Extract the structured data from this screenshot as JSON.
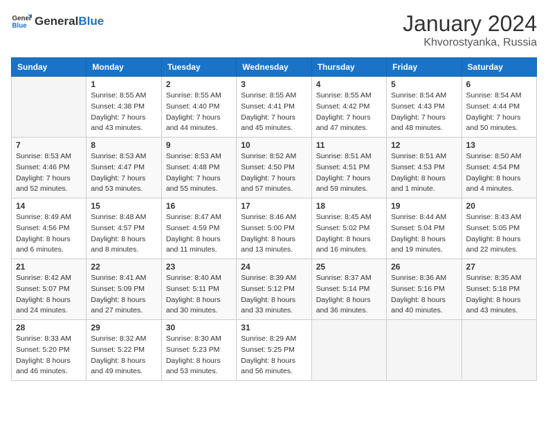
{
  "header": {
    "logo_general": "General",
    "logo_blue": "Blue",
    "title": "January 2024",
    "subtitle": "Khvorostyanka, Russia"
  },
  "days_of_week": [
    "Sunday",
    "Monday",
    "Tuesday",
    "Wednesday",
    "Thursday",
    "Friday",
    "Saturday"
  ],
  "weeks": [
    [
      {
        "num": "",
        "sunrise": "",
        "sunset": "",
        "daylight": "",
        "empty": true
      },
      {
        "num": "1",
        "sunrise": "Sunrise: 8:55 AM",
        "sunset": "Sunset: 4:38 PM",
        "daylight": "Daylight: 7 hours and 43 minutes."
      },
      {
        "num": "2",
        "sunrise": "Sunrise: 8:55 AM",
        "sunset": "Sunset: 4:40 PM",
        "daylight": "Daylight: 7 hours and 44 minutes."
      },
      {
        "num": "3",
        "sunrise": "Sunrise: 8:55 AM",
        "sunset": "Sunset: 4:41 PM",
        "daylight": "Daylight: 7 hours and 45 minutes."
      },
      {
        "num": "4",
        "sunrise": "Sunrise: 8:55 AM",
        "sunset": "Sunset: 4:42 PM",
        "daylight": "Daylight: 7 hours and 47 minutes."
      },
      {
        "num": "5",
        "sunrise": "Sunrise: 8:54 AM",
        "sunset": "Sunset: 4:43 PM",
        "daylight": "Daylight: 7 hours and 48 minutes."
      },
      {
        "num": "6",
        "sunrise": "Sunrise: 8:54 AM",
        "sunset": "Sunset: 4:44 PM",
        "daylight": "Daylight: 7 hours and 50 minutes."
      }
    ],
    [
      {
        "num": "7",
        "sunrise": "Sunrise: 8:53 AM",
        "sunset": "Sunset: 4:46 PM",
        "daylight": "Daylight: 7 hours and 52 minutes."
      },
      {
        "num": "8",
        "sunrise": "Sunrise: 8:53 AM",
        "sunset": "Sunset: 4:47 PM",
        "daylight": "Daylight: 7 hours and 53 minutes."
      },
      {
        "num": "9",
        "sunrise": "Sunrise: 8:53 AM",
        "sunset": "Sunset: 4:48 PM",
        "daylight": "Daylight: 7 hours and 55 minutes."
      },
      {
        "num": "10",
        "sunrise": "Sunrise: 8:52 AM",
        "sunset": "Sunset: 4:50 PM",
        "daylight": "Daylight: 7 hours and 57 minutes."
      },
      {
        "num": "11",
        "sunrise": "Sunrise: 8:51 AM",
        "sunset": "Sunset: 4:51 PM",
        "daylight": "Daylight: 7 hours and 59 minutes."
      },
      {
        "num": "12",
        "sunrise": "Sunrise: 8:51 AM",
        "sunset": "Sunset: 4:53 PM",
        "daylight": "Daylight: 8 hours and 1 minute."
      },
      {
        "num": "13",
        "sunrise": "Sunrise: 8:50 AM",
        "sunset": "Sunset: 4:54 PM",
        "daylight": "Daylight: 8 hours and 4 minutes."
      }
    ],
    [
      {
        "num": "14",
        "sunrise": "Sunrise: 8:49 AM",
        "sunset": "Sunset: 4:56 PM",
        "daylight": "Daylight: 8 hours and 6 minutes."
      },
      {
        "num": "15",
        "sunrise": "Sunrise: 8:48 AM",
        "sunset": "Sunset: 4:57 PM",
        "daylight": "Daylight: 8 hours and 8 minutes."
      },
      {
        "num": "16",
        "sunrise": "Sunrise: 8:47 AM",
        "sunset": "Sunset: 4:59 PM",
        "daylight": "Daylight: 8 hours and 11 minutes."
      },
      {
        "num": "17",
        "sunrise": "Sunrise: 8:46 AM",
        "sunset": "Sunset: 5:00 PM",
        "daylight": "Daylight: 8 hours and 13 minutes."
      },
      {
        "num": "18",
        "sunrise": "Sunrise: 8:45 AM",
        "sunset": "Sunset: 5:02 PM",
        "daylight": "Daylight: 8 hours and 16 minutes."
      },
      {
        "num": "19",
        "sunrise": "Sunrise: 8:44 AM",
        "sunset": "Sunset: 5:04 PM",
        "daylight": "Daylight: 8 hours and 19 minutes."
      },
      {
        "num": "20",
        "sunrise": "Sunrise: 8:43 AM",
        "sunset": "Sunset: 5:05 PM",
        "daylight": "Daylight: 8 hours and 22 minutes."
      }
    ],
    [
      {
        "num": "21",
        "sunrise": "Sunrise: 8:42 AM",
        "sunset": "Sunset: 5:07 PM",
        "daylight": "Daylight: 8 hours and 24 minutes."
      },
      {
        "num": "22",
        "sunrise": "Sunrise: 8:41 AM",
        "sunset": "Sunset: 5:09 PM",
        "daylight": "Daylight: 8 hours and 27 minutes."
      },
      {
        "num": "23",
        "sunrise": "Sunrise: 8:40 AM",
        "sunset": "Sunset: 5:11 PM",
        "daylight": "Daylight: 8 hours and 30 minutes."
      },
      {
        "num": "24",
        "sunrise": "Sunrise: 8:39 AM",
        "sunset": "Sunset: 5:12 PM",
        "daylight": "Daylight: 8 hours and 33 minutes."
      },
      {
        "num": "25",
        "sunrise": "Sunrise: 8:37 AM",
        "sunset": "Sunset: 5:14 PM",
        "daylight": "Daylight: 8 hours and 36 minutes."
      },
      {
        "num": "26",
        "sunrise": "Sunrise: 8:36 AM",
        "sunset": "Sunset: 5:16 PM",
        "daylight": "Daylight: 8 hours and 40 minutes."
      },
      {
        "num": "27",
        "sunrise": "Sunrise: 8:35 AM",
        "sunset": "Sunset: 5:18 PM",
        "daylight": "Daylight: 8 hours and 43 minutes."
      }
    ],
    [
      {
        "num": "28",
        "sunrise": "Sunrise: 8:33 AM",
        "sunset": "Sunset: 5:20 PM",
        "daylight": "Daylight: 8 hours and 46 minutes."
      },
      {
        "num": "29",
        "sunrise": "Sunrise: 8:32 AM",
        "sunset": "Sunset: 5:22 PM",
        "daylight": "Daylight: 8 hours and 49 minutes."
      },
      {
        "num": "30",
        "sunrise": "Sunrise: 8:30 AM",
        "sunset": "Sunset: 5:23 PM",
        "daylight": "Daylight: 8 hours and 53 minutes."
      },
      {
        "num": "31",
        "sunrise": "Sunrise: 8:29 AM",
        "sunset": "Sunset: 5:25 PM",
        "daylight": "Daylight: 8 hours and 56 minutes."
      },
      {
        "num": "",
        "sunrise": "",
        "sunset": "",
        "daylight": "",
        "empty": true
      },
      {
        "num": "",
        "sunrise": "",
        "sunset": "",
        "daylight": "",
        "empty": true
      },
      {
        "num": "",
        "sunrise": "",
        "sunset": "",
        "daylight": "",
        "empty": true
      }
    ]
  ]
}
